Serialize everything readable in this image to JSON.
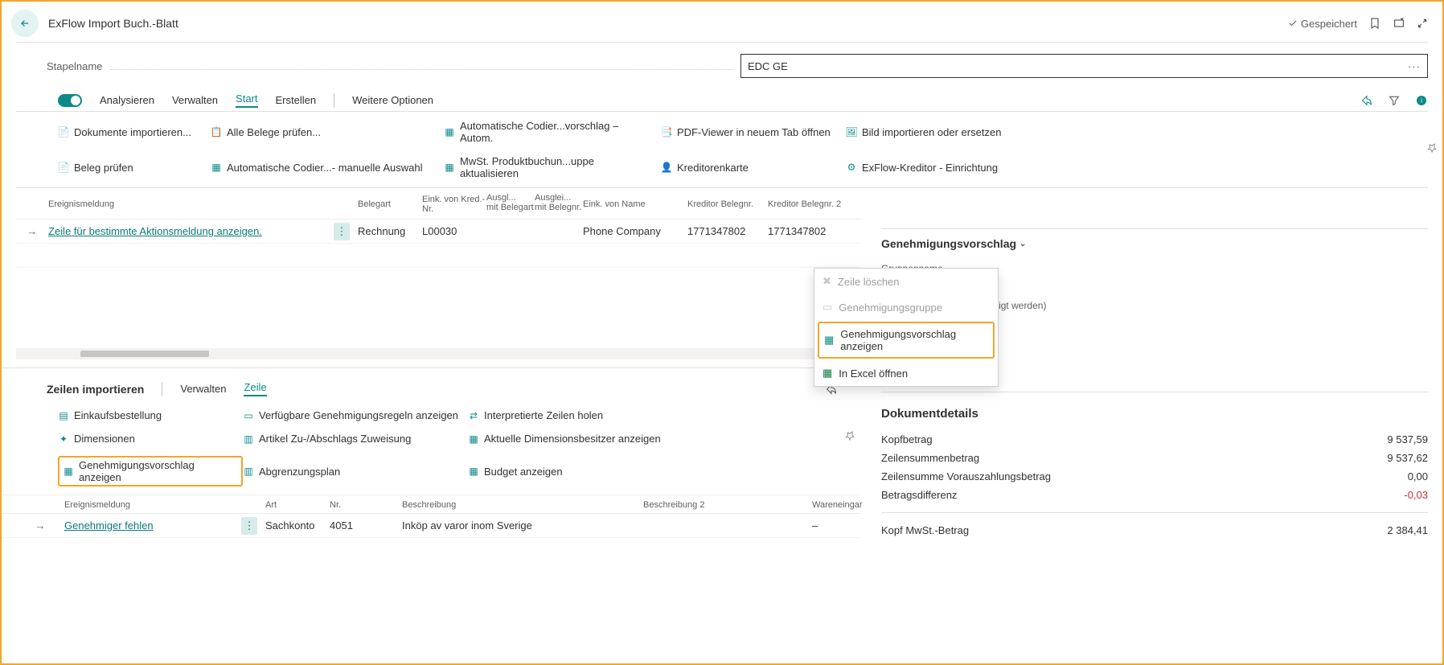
{
  "header": {
    "title": "ExFlow Import Buch.-Blatt",
    "saved": "Gespeichert"
  },
  "batch": {
    "label": "Stapelname",
    "value": "EDC GE"
  },
  "menu": {
    "analyse": "Analysieren",
    "manage": "Verwalten",
    "start": "Start",
    "create": "Erstellen",
    "more": "Weitere Optionen"
  },
  "actions": {
    "import_docs": "Dokumente importieren...",
    "check_all": "Alle Belege prüfen...",
    "auto_coding": "Automatische Codier...vorschlag – Autom.",
    "pdf_viewer": "PDF-Viewer in neuem Tab öffnen",
    "import_image": "Bild importieren oder ersetzen",
    "check_doc": "Beleg prüfen",
    "auto_coding_manual": "Automatische Codier...- manuelle Auswahl",
    "vat_update": "MwSt. Produktbuchun...uppe aktualisieren",
    "vendor_card": "Kreditorenkarte",
    "exflow_vendor_setup": "ExFlow-Kreditor - Einrichtung"
  },
  "main_table": {
    "cols": {
      "event": "Ereignismeldung",
      "doc_type": "Belegart",
      "vendor_no": "Eink. von Kred.-Nr.",
      "applies_type_1": "Ausgl...",
      "applies_type_2": "mit Belegart",
      "applies_no_1": "Ausglei...",
      "applies_no_2": "mit Belegnr.",
      "vendor_name": "Eink. von Name",
      "vendor_doc_no": "Kreditor Belegnr.",
      "vendor_doc_no2": "Kreditor Belegnr. 2"
    },
    "row": {
      "event": "Zeile für bestimmte Aktionsmeldung anzeigen.",
      "doc_type": "Rechnung",
      "vendor_no": "L00030",
      "vendor_name": "Phone Company",
      "vendor_doc_no": "1771347802",
      "vendor_doc_no2": "1771347802"
    }
  },
  "right_panel": {
    "approval_title": "Genehmigungsvorschlag",
    "group_name": "Gruppenname",
    "nothing": "Ansicht kann nichts angezeigt werden)",
    "popup": {
      "delete": "Zeile löschen",
      "group": "Genehmigungsgruppe",
      "show": "Genehmigungsvorschlag anzeigen",
      "excel": "In Excel öffnen"
    },
    "doc_details_title": "Dokumentdetails",
    "kv": {
      "head_amount_l": "Kopfbetrag",
      "head_amount_v": "9 537,59",
      "lines_amount_l": "Zeilensummenbetrag",
      "lines_amount_v": "9 537,62",
      "prepay_l": "Zeilensumme Vorauszahlungsbetrag",
      "prepay_v": "0,00",
      "diff_l": "Betragsdifferenz",
      "diff_v": "-0,03",
      "vat_head_l": "Kopf MwSt.-Betrag",
      "vat_head_v": "2 384,41"
    }
  },
  "lines": {
    "title": "Zeilen importieren",
    "manage": "Verwalten",
    "line": "Zeile",
    "actions": {
      "purchase_order": "Einkaufsbestellung",
      "avail_rules": "Verfügbare Genehmigungsregeln anzeigen",
      "interpreted": "Interpretierte Zeilen holen",
      "dimensions": "Dimensionen",
      "item_charge": "Artikel Zu-/Abschlags Zuweisung",
      "dim_owners": "Aktuelle Dimensionsbesitzer anzeigen",
      "show_approval": "Genehmigungsvorschlag anzeigen",
      "deferral": "Abgrenzungsplan",
      "budget": "Budget anzeigen"
    },
    "cols": {
      "event": "Ereignismeldung",
      "type": "Art",
      "no": "Nr.",
      "desc": "Beschreibung",
      "desc2": "Beschreibung 2",
      "receipt": "Wareneingar"
    },
    "row": {
      "event": "Genehmiger fehlen",
      "type": "Sachkonto",
      "no": "4051",
      "desc": "Inköp av varor inom Sverige",
      "receipt": "–"
    }
  }
}
